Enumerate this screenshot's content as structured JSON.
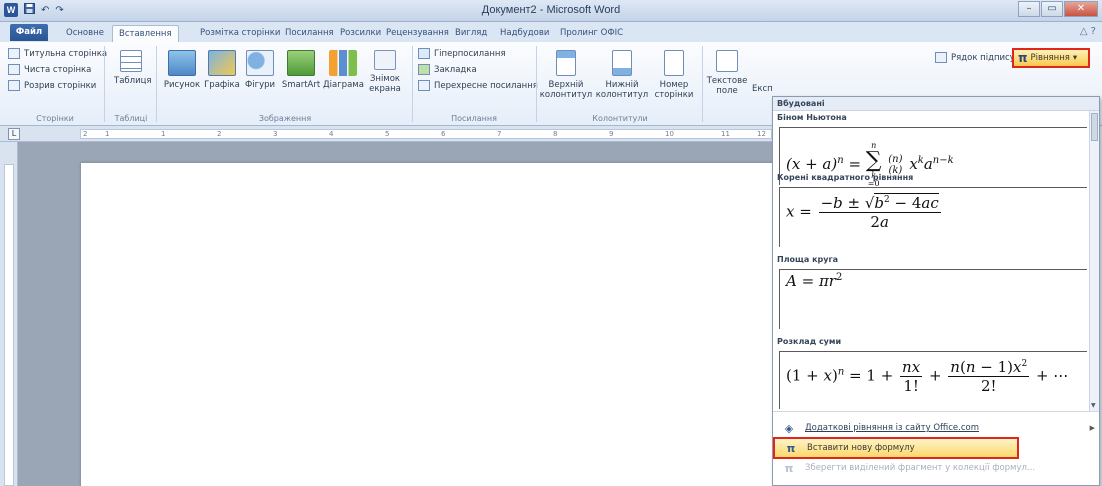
{
  "window": {
    "title": "Документ2 - Microsoft Word",
    "buttons": [
      "–",
      "▭",
      "✕"
    ]
  },
  "quick_access": {
    "word_icon": "W",
    "save": "save-icon",
    "undo": "↶",
    "redo": "↷"
  },
  "tabs": {
    "file": "Файл",
    "items": [
      "Основне",
      "Вставлення",
      "Розмітка сторінки",
      "Посилання",
      "Розсилки",
      "Рецензування",
      "Вигляд",
      "Надбудови",
      "Пролинг ОФІС"
    ],
    "active_index": 1
  },
  "ribbon": {
    "pages": {
      "cover": "Титульна сторінка",
      "blank": "Чиста сторінка",
      "break": "Розрив сторінки",
      "label": "Сторінки"
    },
    "tables": {
      "table": "Таблиця",
      "label": "Таблиці"
    },
    "illustrations": {
      "picture": "Рисунок",
      "clipart": "Графіка",
      "shapes": "Фігури",
      "smartart": "SmartArt",
      "chart": "Діаграма",
      "screenshot_1": "Знімок",
      "screenshot_2": "екрана",
      "label": "Зображення"
    },
    "links": {
      "hyperlink": "Гіперпосилання",
      "bookmark": "Закладка",
      "crossref": "Перехресне посилання",
      "label": "Посилання"
    },
    "header_footer": {
      "header_1": "Верхній",
      "header_2": "колонтитул",
      "footer_1": "Нижній",
      "footer_2": "колонтитул",
      "pagenum_1": "Номер",
      "pagenum_2": "сторінки",
      "label": "Колонтитули"
    },
    "text": {
      "textbox_1": "Текстове",
      "textbox_2": "поле",
      "express": "Експ",
      "signature": "Рядок підпису"
    },
    "equation_button": "Рівняння"
  },
  "ruler": {
    "tab_marker": "L",
    "numbers": [
      "2",
      "1",
      "1",
      "2",
      "3",
      "4",
      "5",
      "6",
      "7",
      "8",
      "9",
      "10",
      "11",
      "12"
    ]
  },
  "gallery": {
    "header": "Вбудовані",
    "equations": [
      {
        "name": "Біном Ньютона"
      },
      {
        "name": "Корені квадратного рівняння"
      },
      {
        "name": "Площа круга"
      },
      {
        "name": "Розклад суми"
      }
    ],
    "menu": [
      {
        "label": "Додаткові рівняння із сайту Office.com",
        "icon": "office-icon"
      },
      {
        "label": "Вставити нову формулу",
        "icon": "pi-icon"
      },
      {
        "label": "Зберегти виділений фрагмент у колекції формул...",
        "icon": "save-equation-icon"
      }
    ]
  }
}
